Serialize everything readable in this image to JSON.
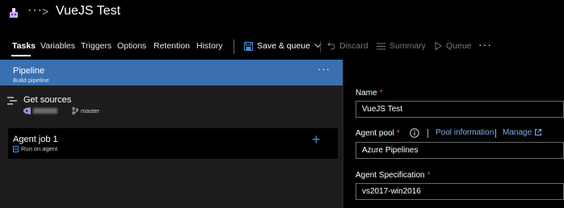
{
  "header": {
    "title": "VueJS Test",
    "more_label": "···",
    "separator": ">"
  },
  "tabs": [
    {
      "label": "Tasks",
      "active": true
    },
    {
      "label": "Variables"
    },
    {
      "label": "Triggers"
    },
    {
      "label": "Options"
    },
    {
      "label": "Retention"
    },
    {
      "label": "History"
    }
  ],
  "toolbar": {
    "save_queue_label": "Save & queue",
    "discard_label": "Discard",
    "summary_label": "Summary",
    "queue_label": "Queue",
    "more_label": "···"
  },
  "pipeline": {
    "title": "Pipeline",
    "subtitle": "Build pipeline",
    "more_label": "···"
  },
  "get_sources": {
    "title": "Get sources",
    "branch": "master"
  },
  "agent_job": {
    "title": "Agent job 1",
    "subtitle": "Run on agent",
    "add_label": "+"
  },
  "form": {
    "name_label": "Name",
    "name_value": "VueJS Test",
    "agent_pool_label": "Agent pool",
    "pool_info_link": "Pool information",
    "manage_link": "Manage",
    "agent_pool_value": "Azure Pipelines",
    "agent_spec_label": "Agent Specification",
    "agent_spec_value": "vs2017-win2016",
    "required_mark": "*"
  },
  "colors": {
    "accent": "#3a6fb0",
    "link": "#7cb0e8",
    "required": "#e05a5a",
    "add_button": "#4e8ad6"
  }
}
